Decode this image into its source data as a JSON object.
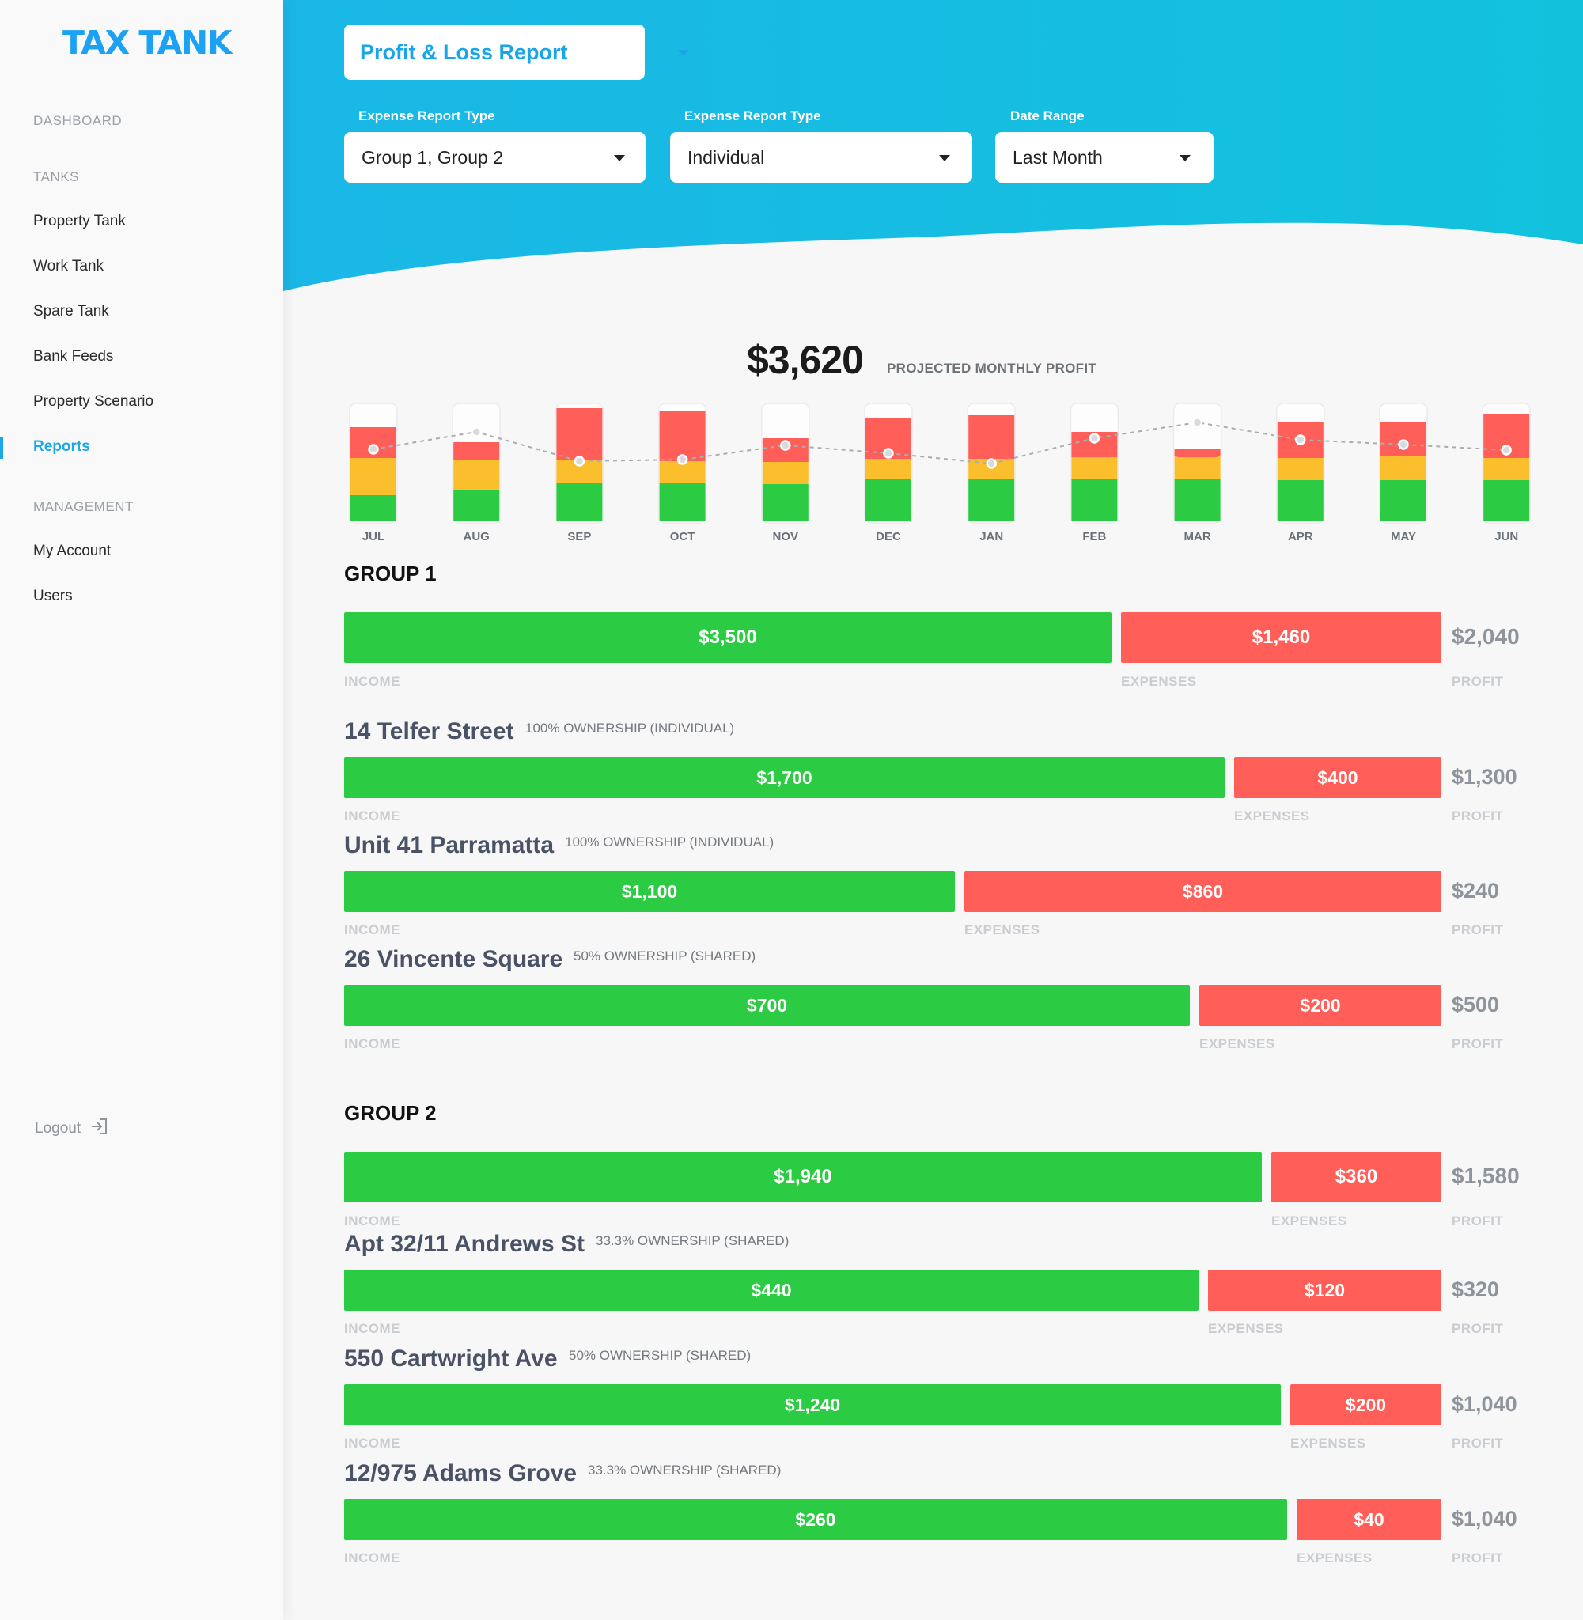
{
  "brand": "TAX TANK",
  "nav": {
    "dashboard": "DASHBOARD",
    "tanks": "TANKS",
    "property_tank": "Property Tank",
    "work_tank": "Work Tank",
    "spare_tank": "Spare Tank",
    "bank_feeds": "Bank Feeds",
    "property_scenario": "Property Scenario",
    "reports": "Reports",
    "management": "MANAGEMENT",
    "my_account": "My Account",
    "users": "Users",
    "logout": "Logout"
  },
  "header": {
    "report_type": "Profit & Loss Report",
    "filters": [
      {
        "label": "Expense Report Type",
        "value": "Group 1, Group 2"
      },
      {
        "label": "Expense Report Type",
        "value": "Individual"
      },
      {
        "label": "Date Range",
        "value": "Last Month"
      }
    ],
    "bg_colors": [
      "#1ab7e6",
      "#12c2dd"
    ]
  },
  "projected": {
    "value": "$3,620",
    "label": "PROJECTED MONTHLY PROFIT"
  },
  "chart_data": {
    "type": "bar",
    "stacked": true,
    "categories": [
      "JUL",
      "AUG",
      "SEP",
      "OCT",
      "NOV",
      "DEC",
      "JAN",
      "FEB",
      "MAR",
      "APR",
      "MAY",
      "JUN"
    ],
    "series": [
      {
        "color": "#2ccb44",
        "values": [
          33,
          40,
          48,
          48,
          47,
          53,
          53,
          53,
          53,
          52,
          52,
          52
        ]
      },
      {
        "color": "#fbbf2d",
        "values": [
          47,
          38,
          30,
          28,
          28,
          26,
          26,
          28,
          29,
          28,
          30,
          28
        ]
      },
      {
        "color": "#ff5f58",
        "values": [
          39,
          22,
          65,
          63,
          30,
          52,
          55,
          32,
          9,
          46,
          43,
          56
        ]
      }
    ],
    "line": [
      91,
      113,
      76,
      78,
      96,
      86,
      73,
      105,
      125,
      103,
      97,
      90
    ],
    "ylim": [
      0,
      150
    ],
    "grid": false,
    "legend": "none"
  },
  "labels": {
    "income": "INCOME",
    "expenses": "EXPENSES",
    "profit": "PROFIT"
  },
  "groups": [
    {
      "title": "GROUP 1",
      "income": 3500,
      "income_label": "$3,500",
      "expenses": 1460,
      "expenses_label": "$1,460",
      "profit_label": "$2,040",
      "properties": [
        {
          "name": "14 Telfer Street",
          "ownership": "100% OWNERSHIP (INDIVIDUAL)",
          "income": 1700,
          "income_label": "$1,700",
          "expenses": 400,
          "expenses_label": "$400",
          "profit_label": "$1,300"
        },
        {
          "name": "Unit 41 Parramatta",
          "ownership": "100% OWNERSHIP (INDIVIDUAL)",
          "income": 1100,
          "income_label": "$1,100",
          "expenses": 860,
          "expenses_label": "$860",
          "profit_label": "$240"
        },
        {
          "name": "26 Vincente Square",
          "ownership": "50% OWNERSHIP (SHARED)",
          "income": 700,
          "income_label": "$700",
          "expenses": 200,
          "expenses_label": "$200",
          "profit_label": "$500"
        }
      ]
    },
    {
      "title": "GROUP 2",
      "income": 1940,
      "income_label": "$1,940",
      "expenses": 360,
      "expenses_label": "$360",
      "profit_label": "$1,580",
      "properties": [
        {
          "name": "Apt 32/11 Andrews St",
          "ownership": "33.3% OWNERSHIP (SHARED)",
          "income": 440,
          "income_label": "$440",
          "expenses": 120,
          "expenses_label": "$120",
          "profit_label": "$320"
        },
        {
          "name": "550 Cartwright Ave",
          "ownership": "50% OWNERSHIP (SHARED)",
          "income": 1240,
          "income_label": "$1,240",
          "expenses": 200,
          "expenses_label": "$200",
          "profit_label": "$1,040"
        },
        {
          "name": "12/975 Adams Grove",
          "ownership": "33.3% OWNERSHIP (SHARED)",
          "income": 260,
          "income_label": "$260",
          "expenses": 40,
          "expenses_label": "$40",
          "profit_label": "$1,040"
        }
      ]
    }
  ]
}
